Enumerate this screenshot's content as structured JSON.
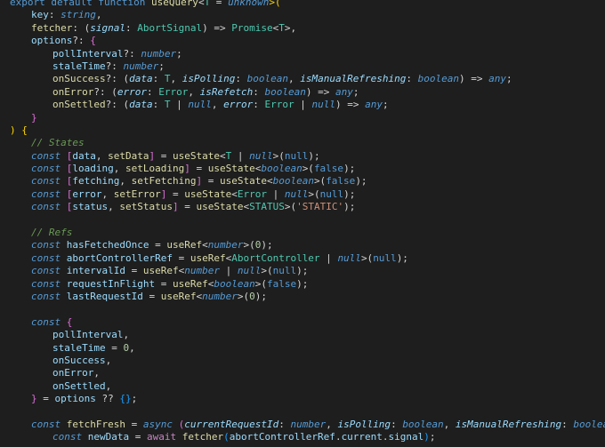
{
  "lines": [
    [
      {
        "t": "export default ",
        "c": "kw"
      },
      {
        "t": "function ",
        "c": "kw"
      },
      {
        "t": "useQuery",
        "c": "fn"
      },
      {
        "t": "<",
        "c": "pl"
      },
      {
        "t": "T",
        "c": "ty"
      },
      {
        "t": " = ",
        "c": "pl"
      },
      {
        "t": "unknown",
        "c": "kw it"
      },
      {
        "t": ">(",
        "c": "br1"
      }
    ],
    [
      {
        "t": "key",
        "c": "var"
      },
      {
        "t": ": ",
        "c": "pl"
      },
      {
        "t": "string",
        "c": "kw it"
      },
      {
        "t": ",",
        "c": "pl"
      }
    ],
    [
      {
        "t": "fetcher",
        "c": "fn"
      },
      {
        "t": ": (",
        "c": "pl"
      },
      {
        "t": "signal",
        "c": "var it"
      },
      {
        "t": ": ",
        "c": "pl"
      },
      {
        "t": "AbortSignal",
        "c": "ty"
      },
      {
        "t": ") => ",
        "c": "pl"
      },
      {
        "t": "Promise",
        "c": "ty"
      },
      {
        "t": "<",
        "c": "pl"
      },
      {
        "t": "T",
        "c": "ty"
      },
      {
        "t": ">,",
        "c": "pl"
      }
    ],
    [
      {
        "t": "options",
        "c": "var"
      },
      {
        "t": "?: ",
        "c": "pl"
      },
      {
        "t": "{",
        "c": "br2"
      }
    ],
    [
      {
        "t": "pollInterval",
        "c": "prop"
      },
      {
        "t": "?: ",
        "c": "pl"
      },
      {
        "t": "number",
        "c": "kw it"
      },
      {
        "t": ";",
        "c": "pl"
      }
    ],
    [
      {
        "t": "staleTime",
        "c": "prop"
      },
      {
        "t": "?: ",
        "c": "pl"
      },
      {
        "t": "number",
        "c": "kw it"
      },
      {
        "t": ";",
        "c": "pl"
      }
    ],
    [
      {
        "t": "onSuccess",
        "c": "fn"
      },
      {
        "t": "?: (",
        "c": "pl"
      },
      {
        "t": "data",
        "c": "var it"
      },
      {
        "t": ": ",
        "c": "pl"
      },
      {
        "t": "T",
        "c": "ty"
      },
      {
        "t": ", ",
        "c": "pl"
      },
      {
        "t": "isPolling",
        "c": "var it"
      },
      {
        "t": ": ",
        "c": "pl"
      },
      {
        "t": "boolean",
        "c": "kw it"
      },
      {
        "t": ", ",
        "c": "pl"
      },
      {
        "t": "isManualRefreshing",
        "c": "var it"
      },
      {
        "t": ": ",
        "c": "pl"
      },
      {
        "t": "boolean",
        "c": "kw it"
      },
      {
        "t": ") => ",
        "c": "pl"
      },
      {
        "t": "any",
        "c": "kw it"
      },
      {
        "t": ";",
        "c": "pl"
      }
    ],
    [
      {
        "t": "onError",
        "c": "fn"
      },
      {
        "t": "?: (",
        "c": "pl"
      },
      {
        "t": "error",
        "c": "var it"
      },
      {
        "t": ": ",
        "c": "pl"
      },
      {
        "t": "Error",
        "c": "ty"
      },
      {
        "t": ", ",
        "c": "pl"
      },
      {
        "t": "isRefetch",
        "c": "var it"
      },
      {
        "t": ": ",
        "c": "pl"
      },
      {
        "t": "boolean",
        "c": "kw it"
      },
      {
        "t": ") => ",
        "c": "pl"
      },
      {
        "t": "any",
        "c": "kw it"
      },
      {
        "t": ";",
        "c": "pl"
      }
    ],
    [
      {
        "t": "onSettled",
        "c": "fn"
      },
      {
        "t": "?: (",
        "c": "pl"
      },
      {
        "t": "data",
        "c": "var it"
      },
      {
        "t": ": ",
        "c": "pl"
      },
      {
        "t": "T",
        "c": "ty"
      },
      {
        "t": " | ",
        "c": "pl"
      },
      {
        "t": "null",
        "c": "kw it"
      },
      {
        "t": ", ",
        "c": "pl"
      },
      {
        "t": "error",
        "c": "var it"
      },
      {
        "t": ": ",
        "c": "pl"
      },
      {
        "t": "Error",
        "c": "ty"
      },
      {
        "t": " | ",
        "c": "pl"
      },
      {
        "t": "null",
        "c": "kw it"
      },
      {
        "t": ") => ",
        "c": "pl"
      },
      {
        "t": "any",
        "c": "kw it"
      },
      {
        "t": ";",
        "c": "pl"
      }
    ],
    [
      {
        "t": "}",
        "c": "br2"
      }
    ],
    [
      {
        "t": ")",
        "c": "br1"
      },
      {
        "t": " ",
        "c": "pl"
      },
      {
        "t": "{",
        "c": "br1"
      }
    ],
    [
      {
        "t": "// States",
        "c": "cm"
      }
    ],
    [
      {
        "t": "const ",
        "c": "kw it"
      },
      {
        "t": "[",
        "c": "br2"
      },
      {
        "t": "data",
        "c": "var"
      },
      {
        "t": ", ",
        "c": "pl"
      },
      {
        "t": "setData",
        "c": "fn"
      },
      {
        "t": "]",
        "c": "br2"
      },
      {
        "t": " = ",
        "c": "pl"
      },
      {
        "t": "useState",
        "c": "fn"
      },
      {
        "t": "<",
        "c": "pl"
      },
      {
        "t": "T",
        "c": "ty"
      },
      {
        "t": " | ",
        "c": "pl"
      },
      {
        "t": "null",
        "c": "kw it"
      },
      {
        "t": ">(",
        "c": "pl"
      },
      {
        "t": "null",
        "c": "kw"
      },
      {
        "t": ");",
        "c": "pl"
      }
    ],
    [
      {
        "t": "const ",
        "c": "kw it"
      },
      {
        "t": "[",
        "c": "br2"
      },
      {
        "t": "loading",
        "c": "var"
      },
      {
        "t": ", ",
        "c": "pl"
      },
      {
        "t": "setLoading",
        "c": "fn"
      },
      {
        "t": "]",
        "c": "br2"
      },
      {
        "t": " = ",
        "c": "pl"
      },
      {
        "t": "useState",
        "c": "fn"
      },
      {
        "t": "<",
        "c": "pl"
      },
      {
        "t": "boolean",
        "c": "kw it"
      },
      {
        "t": ">(",
        "c": "pl"
      },
      {
        "t": "false",
        "c": "kw"
      },
      {
        "t": ");",
        "c": "pl"
      }
    ],
    [
      {
        "t": "const ",
        "c": "kw it"
      },
      {
        "t": "[",
        "c": "br2"
      },
      {
        "t": "fetching",
        "c": "var"
      },
      {
        "t": ", ",
        "c": "pl"
      },
      {
        "t": "setFetching",
        "c": "fn"
      },
      {
        "t": "]",
        "c": "br2"
      },
      {
        "t": " = ",
        "c": "pl"
      },
      {
        "t": "useState",
        "c": "fn"
      },
      {
        "t": "<",
        "c": "pl"
      },
      {
        "t": "boolean",
        "c": "kw it"
      },
      {
        "t": ">(",
        "c": "pl"
      },
      {
        "t": "false",
        "c": "kw"
      },
      {
        "t": ");",
        "c": "pl"
      }
    ],
    [
      {
        "t": "const ",
        "c": "kw it"
      },
      {
        "t": "[",
        "c": "br2"
      },
      {
        "t": "error",
        "c": "var"
      },
      {
        "t": ", ",
        "c": "pl"
      },
      {
        "t": "setError",
        "c": "fn"
      },
      {
        "t": "]",
        "c": "br2"
      },
      {
        "t": " = ",
        "c": "pl"
      },
      {
        "t": "useState",
        "c": "fn"
      },
      {
        "t": "<",
        "c": "pl"
      },
      {
        "t": "Error",
        "c": "ty"
      },
      {
        "t": " | ",
        "c": "pl"
      },
      {
        "t": "null",
        "c": "kw it"
      },
      {
        "t": ">(",
        "c": "pl"
      },
      {
        "t": "null",
        "c": "kw"
      },
      {
        "t": ");",
        "c": "pl"
      }
    ],
    [
      {
        "t": "const ",
        "c": "kw it"
      },
      {
        "t": "[",
        "c": "br2"
      },
      {
        "t": "status",
        "c": "var"
      },
      {
        "t": ", ",
        "c": "pl"
      },
      {
        "t": "setStatus",
        "c": "fn"
      },
      {
        "t": "]",
        "c": "br2"
      },
      {
        "t": " = ",
        "c": "pl"
      },
      {
        "t": "useState",
        "c": "fn"
      },
      {
        "t": "<",
        "c": "pl"
      },
      {
        "t": "STATUS",
        "c": "ty"
      },
      {
        "t": ">(",
        "c": "pl"
      },
      {
        "t": "'STATIC'",
        "c": "st"
      },
      {
        "t": ");",
        "c": "pl"
      }
    ],
    [],
    [
      {
        "t": "// Refs",
        "c": "cm"
      }
    ],
    [
      {
        "t": "const ",
        "c": "kw it"
      },
      {
        "t": "hasFetchedOnce",
        "c": "var"
      },
      {
        "t": " = ",
        "c": "pl"
      },
      {
        "t": "useRef",
        "c": "fn"
      },
      {
        "t": "<",
        "c": "pl"
      },
      {
        "t": "number",
        "c": "kw it"
      },
      {
        "t": ">(",
        "c": "pl"
      },
      {
        "t": "0",
        "c": "nm"
      },
      {
        "t": ");",
        "c": "pl"
      }
    ],
    [
      {
        "t": "const ",
        "c": "kw it"
      },
      {
        "t": "abortControllerRef",
        "c": "var"
      },
      {
        "t": " = ",
        "c": "pl"
      },
      {
        "t": "useRef",
        "c": "fn"
      },
      {
        "t": "<",
        "c": "pl"
      },
      {
        "t": "AbortController",
        "c": "ty"
      },
      {
        "t": " | ",
        "c": "pl"
      },
      {
        "t": "null",
        "c": "kw it"
      },
      {
        "t": ">(",
        "c": "pl"
      },
      {
        "t": "null",
        "c": "kw"
      },
      {
        "t": ");",
        "c": "pl"
      }
    ],
    [
      {
        "t": "const ",
        "c": "kw it"
      },
      {
        "t": "intervalId",
        "c": "var"
      },
      {
        "t": " = ",
        "c": "pl"
      },
      {
        "t": "useRef",
        "c": "fn"
      },
      {
        "t": "<",
        "c": "pl"
      },
      {
        "t": "number",
        "c": "kw it"
      },
      {
        "t": " | ",
        "c": "pl"
      },
      {
        "t": "null",
        "c": "kw it"
      },
      {
        "t": ">(",
        "c": "pl"
      },
      {
        "t": "null",
        "c": "kw"
      },
      {
        "t": ");",
        "c": "pl"
      }
    ],
    [
      {
        "t": "const ",
        "c": "kw it"
      },
      {
        "t": "requestInFlight",
        "c": "var"
      },
      {
        "t": " = ",
        "c": "pl"
      },
      {
        "t": "useRef",
        "c": "fn"
      },
      {
        "t": "<",
        "c": "pl"
      },
      {
        "t": "boolean",
        "c": "kw it"
      },
      {
        "t": ">(",
        "c": "pl"
      },
      {
        "t": "false",
        "c": "kw"
      },
      {
        "t": ");",
        "c": "pl"
      }
    ],
    [
      {
        "t": "const ",
        "c": "kw it"
      },
      {
        "t": "lastRequestId",
        "c": "var"
      },
      {
        "t": " = ",
        "c": "pl"
      },
      {
        "t": "useRef",
        "c": "fn"
      },
      {
        "t": "<",
        "c": "pl"
      },
      {
        "t": "number",
        "c": "kw it"
      },
      {
        "t": ">(",
        "c": "pl"
      },
      {
        "t": "0",
        "c": "nm"
      },
      {
        "t": ");",
        "c": "pl"
      }
    ],
    [],
    [
      {
        "t": "const ",
        "c": "kw it"
      },
      {
        "t": "{",
        "c": "br2"
      }
    ],
    [
      {
        "t": "pollInterval",
        "c": "var"
      },
      {
        "t": ",",
        "c": "pl"
      }
    ],
    [
      {
        "t": "staleTime",
        "c": "var"
      },
      {
        "t": " = ",
        "c": "pl"
      },
      {
        "t": "0",
        "c": "nm"
      },
      {
        "t": ",",
        "c": "pl"
      }
    ],
    [
      {
        "t": "onSuccess",
        "c": "var"
      },
      {
        "t": ",",
        "c": "pl"
      }
    ],
    [
      {
        "t": "onError",
        "c": "var"
      },
      {
        "t": ",",
        "c": "pl"
      }
    ],
    [
      {
        "t": "onSettled",
        "c": "var"
      },
      {
        "t": ",",
        "c": "pl"
      }
    ],
    [
      {
        "t": "}",
        "c": "br2"
      },
      {
        "t": " = ",
        "c": "pl"
      },
      {
        "t": "options",
        "c": "var"
      },
      {
        "t": " ?? ",
        "c": "pl"
      },
      {
        "t": "{}",
        "c": "br3"
      },
      {
        "t": ";",
        "c": "pl"
      }
    ],
    [],
    [
      {
        "t": "const ",
        "c": "kw it"
      },
      {
        "t": "fetchFresh",
        "c": "fn"
      },
      {
        "t": " = ",
        "c": "pl"
      },
      {
        "t": "async ",
        "c": "kw it"
      },
      {
        "t": "(",
        "c": "br2"
      },
      {
        "t": "currentRequestId",
        "c": "var it"
      },
      {
        "t": ": ",
        "c": "pl"
      },
      {
        "t": "number",
        "c": "kw it"
      },
      {
        "t": ", ",
        "c": "pl"
      },
      {
        "t": "isPolling",
        "c": "var it"
      },
      {
        "t": ": ",
        "c": "pl"
      },
      {
        "t": "boolean",
        "c": "kw it"
      },
      {
        "t": ", ",
        "c": "pl"
      },
      {
        "t": "isManualRefreshing",
        "c": "var it"
      },
      {
        "t": ": ",
        "c": "pl"
      },
      {
        "t": "boolean",
        "c": "kw it"
      },
      {
        "t": ")",
        "c": "br2"
      },
      {
        "t": " => ",
        "c": "pl"
      },
      {
        "t": "{",
        "c": "br2"
      }
    ],
    [
      {
        "t": "const ",
        "c": "kw it"
      },
      {
        "t": "newData",
        "c": "var"
      },
      {
        "t": " = ",
        "c": "pl"
      },
      {
        "t": "await ",
        "c": "ctrl"
      },
      {
        "t": "fetcher",
        "c": "fn"
      },
      {
        "t": "(",
        "c": "br3"
      },
      {
        "t": "abortControllerRef",
        "c": "var"
      },
      {
        "t": ".",
        "c": "pl"
      },
      {
        "t": "current",
        "c": "var"
      },
      {
        "t": ".",
        "c": "pl"
      },
      {
        "t": "signal",
        "c": "var"
      },
      {
        "t": ")",
        "c": "br3"
      },
      {
        "t": ";",
        "c": "pl"
      }
    ]
  ]
}
